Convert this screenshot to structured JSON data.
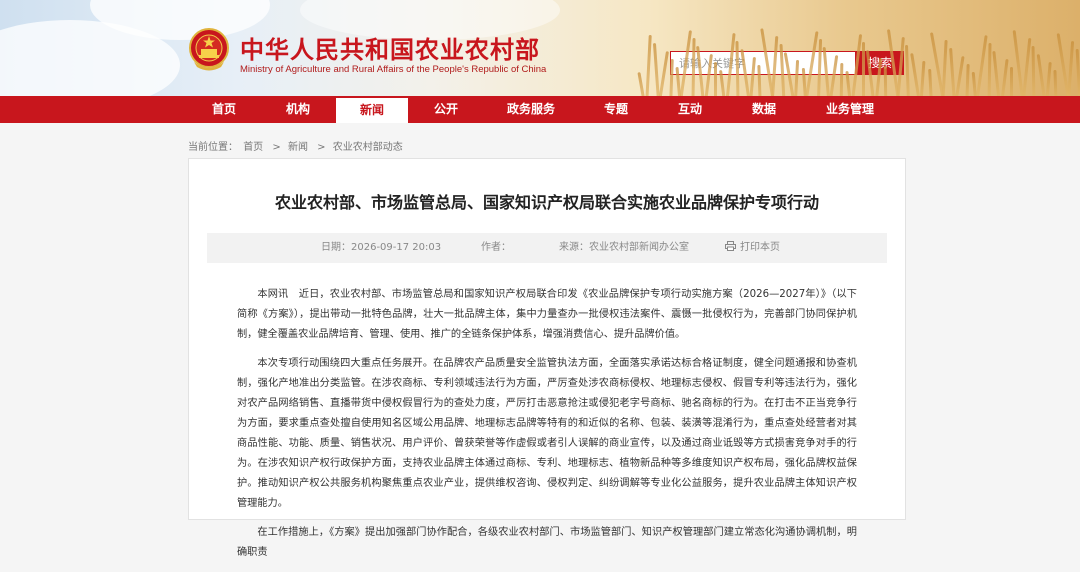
{
  "header": {
    "site_title": "中华人民共和国农业农村部",
    "site_subtitle": "Ministry of Agriculture and Rural Affairs of the People's Republic of China",
    "search_placeholder": "请输入关键字",
    "search_button": "搜索"
  },
  "nav": {
    "items": [
      {
        "label": "首页"
      },
      {
        "label": "机构"
      },
      {
        "label": "新闻",
        "active": true
      },
      {
        "label": "公开"
      },
      {
        "label": "政务服务"
      },
      {
        "label": "专题"
      },
      {
        "label": "互动"
      },
      {
        "label": "数据"
      },
      {
        "label": "业务管理"
      }
    ]
  },
  "breadcrumb": {
    "prefix": "当前位置：",
    "items": [
      "首页",
      "新闻",
      "农业农村部动态"
    ],
    "separator": ">"
  },
  "article": {
    "title": "农业农村部、市场监管总局、国家知识产权局联合实施农业品牌保护专项行动",
    "date": "日期：2026-09-17 20:03",
    "author": "作者：",
    "source": "来源：农业农村部新闻办公室",
    "print": "打印本页",
    "paragraphs": [
      "本网讯　近日，农业农村部、市场监管总局和国家知识产权局联合印发《农业品牌保护专项行动实施方案（2026—2027年）》（以下简称《方案》），提出带动一批特色品牌，壮大一批品牌主体，集中力量查办一批侵权违法案件、震慑一批侵权行为，完善部门协同保护机制，健全覆盖农业品牌培育、管理、使用、推广的全链条保护体系，增强消费信心、提升品牌价值。",
      "本次专项行动围绕四大重点任务展开。在品牌农产品质量安全监管执法方面，全面落实承诺达标合格证制度，健全问题通报和协查机制，强化产地准出分类监管。在涉农商标、专利领域违法行为方面，严厉查处涉农商标侵权、地理标志侵权、假冒专利等违法行为，强化对农产品网络销售、直播带货中侵权假冒行为的查处力度，严厉打击恶意抢注或侵犯老字号商标、驰名商标的行为。在打击不正当竞争行为方面，要求重点查处擅自使用知名区域公用品牌、地理标志品牌等特有的和近似的名称、包装、装潢等混淆行为，重点查处经营者对其商品性能、功能、质量、销售状况、用户评价、曾获荣誉等作虚假或者引人误解的商业宣传，以及通过商业诋毁等方式损害竞争对手的行为。在涉农知识产权行政保护方面，支持农业品牌主体通过商标、专利、地理标志、植物新品种等多维度知识产权布局，强化品牌权益保护。推动知识产权公共服务机构聚焦重点农业产业，提供维权咨询、侵权判定、纠纷调解等专业化公益服务，提升农业品牌主体知识产权管理能力。",
      "在工作措施上，《方案》提出加强部门协作配合，各级农业农村部门、市场监管部门、知识产权管理部门建立常态化沟通协调机制，明确职责"
    ]
  },
  "colors": {
    "brand_red": "#c8161d",
    "nav_active_bg": "#ffffff",
    "meta_bg": "#f2f2f2"
  },
  "icons": [
    "national-emblem-icon",
    "printer-icon"
  ]
}
